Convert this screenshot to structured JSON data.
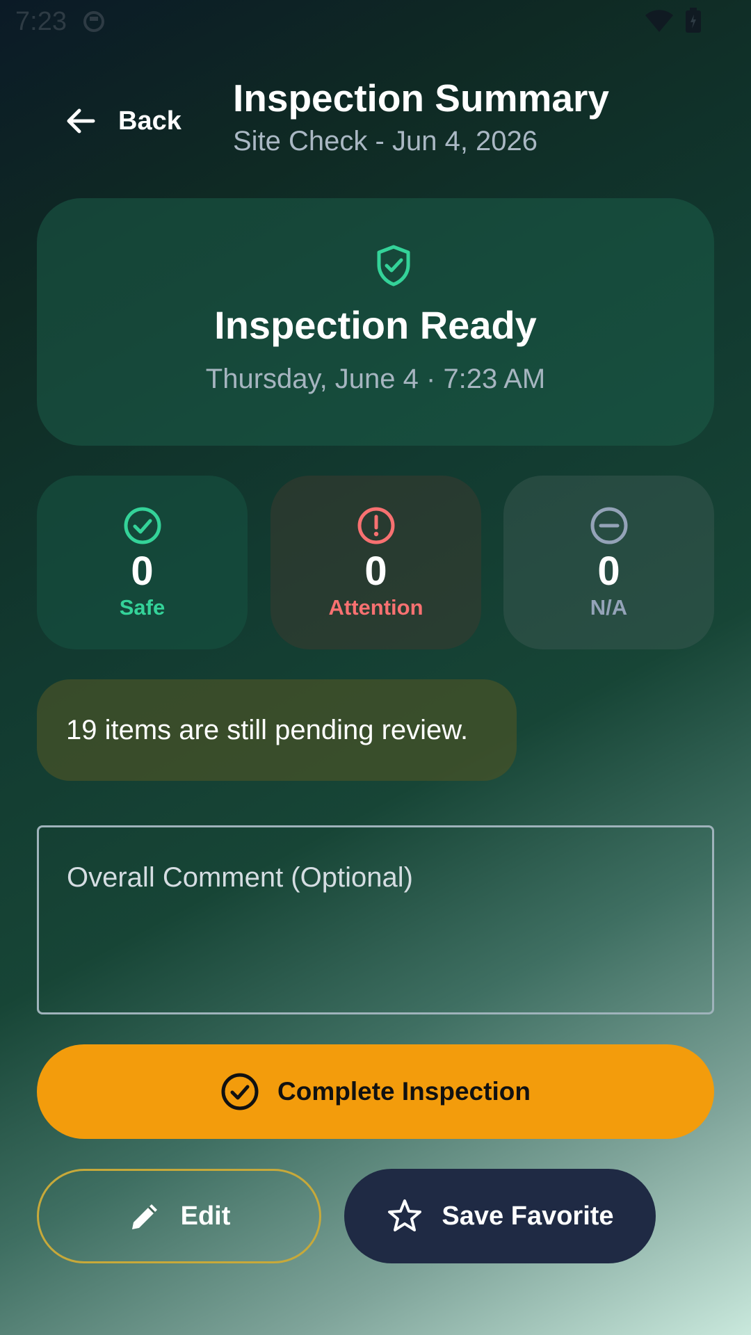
{
  "status_bar": {
    "time": "7:23"
  },
  "header": {
    "back_label": "Back",
    "title": "Inspection Summary",
    "subtitle": "Site Check - Jun 4, 2026"
  },
  "hero": {
    "title": "Inspection Ready",
    "date": "Thursday, June 4 · 7:23 AM",
    "icon": "shield-check-icon"
  },
  "stats": [
    {
      "value": "0",
      "label": "Safe",
      "icon": "check-circle-icon",
      "color": "#34d399"
    },
    {
      "value": "0",
      "label": "Attention",
      "icon": "alert-circle-icon",
      "color": "#f87171"
    },
    {
      "value": "0",
      "label": "N/A",
      "icon": "minus-circle-icon",
      "color": "#94a3b8"
    }
  ],
  "pending_notice": "19 items are still pending review.",
  "comment": {
    "placeholder": "Overall Comment (Optional)",
    "value": ""
  },
  "actions": {
    "complete_label": "Complete Inspection",
    "edit_label": "Edit",
    "favorite_label": "Save Favorite"
  },
  "colors": {
    "accent": "#f39c0c",
    "safe": "#34d399",
    "attention": "#f87171",
    "na": "#94a3b8",
    "favorite_button": "#1f2a44"
  }
}
